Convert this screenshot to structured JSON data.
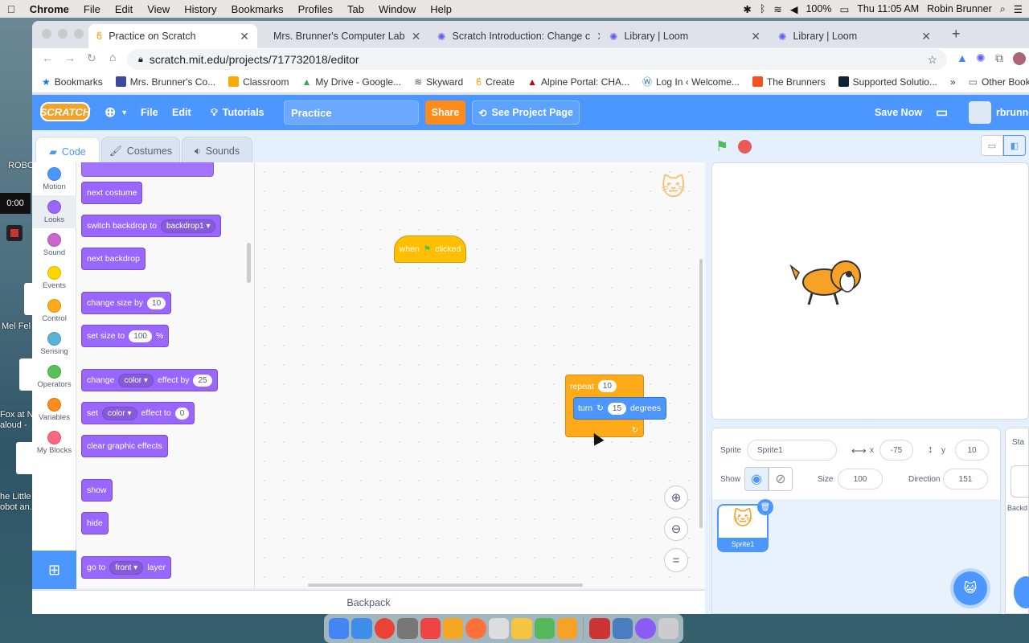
{
  "menubar": {
    "app": "Chrome",
    "items": [
      "File",
      "Edit",
      "View",
      "History",
      "Bookmarks",
      "Profiles",
      "Tab",
      "Window",
      "Help"
    ],
    "battery": "100%",
    "datetime": "Thu 11:05 AM",
    "user": "Robin Brunner"
  },
  "desktop": {
    "labels": [
      "ROBO",
      "0:00",
      "Mel Fel",
      "Fox at N",
      "aloud -",
      "he Little",
      "obot an."
    ],
    "icon_tag": "WE"
  },
  "tabs": [
    {
      "title": "Practice on Scratch"
    },
    {
      "title": "Mrs. Brunner's Computer Lab"
    },
    {
      "title": "Scratch Introduction: Change c"
    },
    {
      "title": "Library | Loom"
    },
    {
      "title": "Library | Loom"
    }
  ],
  "url": "scratch.mit.edu/projects/717732018/editor",
  "bookmarks": [
    "Bookmarks",
    "Mrs. Brunner's Co...",
    "Classroom",
    "My Drive - Google...",
    "Skyward",
    "Create",
    "Alpine Portal: CHA...",
    "Log In ‹ Welcome...",
    "The Brunners",
    "Supported Solutio...",
    "»",
    "Other Book"
  ],
  "scratch": {
    "logo": "SCRATCH",
    "file": "File",
    "edit": "Edit",
    "tutorials": "Tutorials",
    "title": "Practice",
    "share": "Share",
    "see_project": "See Project Page",
    "save": "Save Now",
    "username": "rbrunne",
    "tabs": {
      "code": "Code",
      "costumes": "Costumes",
      "sounds": "Sounds"
    },
    "categories": [
      {
        "name": "Motion",
        "color": "#4c97ff"
      },
      {
        "name": "Looks",
        "color": "#9966ff"
      },
      {
        "name": "Sound",
        "color": "#cf63cf"
      },
      {
        "name": "Events",
        "color": "#ffd500"
      },
      {
        "name": "Control",
        "color": "#ffab19"
      },
      {
        "name": "Sensing",
        "color": "#5cb1d6"
      },
      {
        "name": "Operators",
        "color": "#59c059"
      },
      {
        "name": "Variables",
        "color": "#ff8c1a"
      },
      {
        "name": "My Blocks",
        "color": "#ff6680"
      }
    ],
    "palette": {
      "next_costume": "next costume",
      "switch_backdrop": "switch backdrop to",
      "backdrop_value": "backdrop1",
      "next_backdrop": "next backdrop",
      "change_size": "change size by",
      "change_size_value": "10",
      "set_size": "set size to",
      "set_size_value": "100",
      "percent": "%",
      "change_effect": "change",
      "effect_color": "color",
      "effect_by": "effect by",
      "effect_value": "25",
      "set_effect": "set",
      "effect_to": "effect to",
      "set_effect_value": "0",
      "clear_effects": "clear graphic effects",
      "show": "show",
      "hide": "hide",
      "goto_layer": "go to",
      "layer_value": "front",
      "layer": "layer"
    },
    "script": {
      "when": "when",
      "clicked": "clicked",
      "repeat": "repeat",
      "repeat_value": "10",
      "turn": "turn",
      "turn_value": "15",
      "degrees": "degrees"
    },
    "backpack": "Backpack",
    "sprite": {
      "label": "Sprite",
      "name": "Sprite1",
      "x_label": "x",
      "x": "-75",
      "y_label": "y",
      "y": "10",
      "show": "Show",
      "size_label": "Size",
      "size": "100",
      "direction_label": "Direction",
      "direction": "151",
      "thumb": "Sprite1"
    },
    "stage_tab": "Sta",
    "backdrops": "Backd"
  },
  "dock_colors": [
    "#4285f4",
    "#3d8eea",
    "#ea4335",
    "#777",
    "#e44",
    "#f5a623",
    "#ff7139",
    "#ddd",
    "#f5c542",
    "#57b85b",
    "#f7a226",
    "#c33",
    "#4a7dbf",
    "#8a5cf6",
    "#ccc"
  ]
}
